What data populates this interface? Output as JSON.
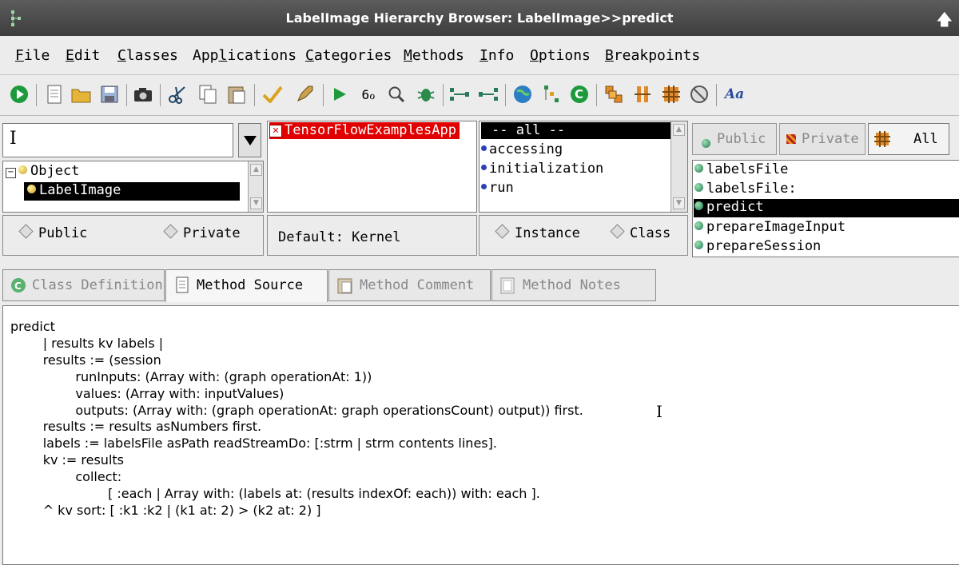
{
  "window": {
    "title": "LabelImage Hierarchy Browser: LabelImage>>predict"
  },
  "menu": {
    "file": "File",
    "edit": "Edit",
    "classes": "Classes",
    "applications": "Applications",
    "categories": "Categories",
    "methods": "Methods",
    "info": "Info",
    "options": "Options",
    "breakpoints": "Breakpoints"
  },
  "toolbar": {
    "font_label": "Aa"
  },
  "search": {
    "value": ""
  },
  "hierarchy": {
    "items": [
      "Object",
      "LabelImage"
    ]
  },
  "applications_list": {
    "items": [
      "TensorFlowExamplesApp"
    ]
  },
  "categories_list": {
    "items": [
      "-- all --",
      "accessing",
      "initialization",
      "run"
    ]
  },
  "visibility_tabs": {
    "public": "Public",
    "private": "Private",
    "all": "All"
  },
  "methods_list": {
    "items": [
      "labelsFile",
      "labelsFile:",
      "predict",
      "prepareImageInput",
      "prepareSession"
    ],
    "selected": "predict"
  },
  "class_visibility": {
    "public": "Public",
    "private": "Private"
  },
  "default_app": {
    "label": "Default: Kernel"
  },
  "side": {
    "instance": "Instance",
    "class": "Class"
  },
  "tabs": {
    "class_definition": "Class Definition",
    "method_source": "Method Source",
    "method_comment": "Method Comment",
    "method_notes": "Method Notes"
  },
  "source": {
    "code": "predict\n\t| results kv labels |\n\tresults := (session\n\t\trunInputs: (Array with: (graph operationAt: 1))\n\t\tvalues: (Array with: inputValues)\n\t\toutputs: (Array with: (graph operationAt: graph operationsCount) output)) first.\n\tresults := results asNumbers first.\n\tlabels := labelsFile asPath readStreamDo: [:strm | strm contents lines].\n\tkv := results\n\t\tcollect:\n\t\t\t[ :each | Array with: (labels at: (results indexOf: each)) with: each ].\n\t^ kv sort: [ :k1 :k2 | (k1 at: 2) > (k2 at: 2) ]"
  }
}
